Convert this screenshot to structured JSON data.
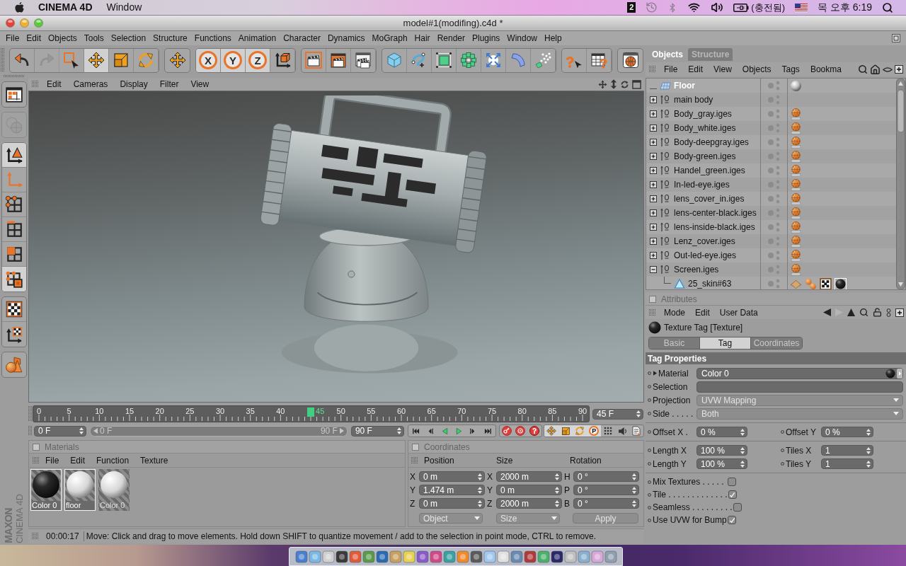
{
  "menubar": {
    "app": "CINEMA 4D",
    "menus": [
      "Window"
    ],
    "spaces": "2",
    "battery": "(충전됨)",
    "clock": "목 오후 6:19"
  },
  "window": {
    "title": "model#1(modifing).c4d *"
  },
  "menu": [
    "File",
    "Edit",
    "Objects",
    "Tools",
    "Selection",
    "Structure",
    "Functions",
    "Animation",
    "Character",
    "Dynamics",
    "MoGraph",
    "Hair",
    "Render",
    "Plugins",
    "Window",
    "Help"
  ],
  "toolbar": [
    {
      "items": [
        {
          "kind": "undo",
          "selected": false,
          "disabled": false
        },
        {
          "kind": "redo",
          "selected": false,
          "disabled": true
        },
        {
          "kind": "select",
          "selected": false,
          "disabled": false
        },
        {
          "kind": "move",
          "selected": true,
          "disabled": false
        },
        {
          "kind": "scale",
          "selected": false,
          "disabled": false
        },
        {
          "kind": "rotate",
          "selected": false,
          "disabled": false
        }
      ]
    },
    {
      "items": [
        {
          "kind": "world"
        }
      ]
    },
    {
      "items": [
        {
          "kind": "lock",
          "label": "X",
          "selected": true
        },
        {
          "kind": "lock",
          "label": "Y",
          "selected": true
        },
        {
          "kind": "lock",
          "label": "Z",
          "selected": true
        },
        {
          "kind": "coords",
          "selected": false
        }
      ]
    },
    {
      "items": [
        {
          "kind": "render_view"
        },
        {
          "kind": "render_viewer"
        },
        {
          "kind": "render_settings"
        }
      ]
    },
    {
      "items": [
        {
          "kind": "cube"
        },
        {
          "kind": "spline"
        },
        {
          "kind": "nurbs"
        },
        {
          "kind": "array"
        },
        {
          "kind": "deformer"
        },
        {
          "kind": "environment"
        },
        {
          "kind": "particles"
        }
      ]
    },
    {
      "items": [
        {
          "kind": "help"
        },
        {
          "kind": "help_table"
        }
      ]
    },
    {
      "items": [
        {
          "kind": "web"
        }
      ]
    }
  ],
  "left_toolbar": [
    {
      "items": [
        {
          "kind": "model",
          "selected": false,
          "disabled": false
        }
      ]
    },
    {
      "items": [
        {
          "kind": "texture",
          "selected": false,
          "disabled": true
        }
      ]
    },
    {
      "items": [
        {
          "kind": "object_axis",
          "selected": true,
          "disabled": false
        },
        {
          "kind": "axis",
          "selected": false,
          "disabled": false
        },
        {
          "kind": "points",
          "selected": false,
          "disabled": false
        },
        {
          "kind": "edges",
          "selected": false,
          "disabled": false
        },
        {
          "kind": "polygons",
          "selected": false,
          "disabled": false
        },
        {
          "kind": "live",
          "selected": true,
          "disabled": false
        }
      ]
    },
    {
      "items": [
        {
          "kind": "texture_mode",
          "selected": false,
          "disabled": false
        },
        {
          "kind": "workplane",
          "selected": false,
          "disabled": false
        }
      ]
    },
    {
      "items": [
        {
          "kind": "primitives",
          "selected": false,
          "disabled": false
        }
      ]
    }
  ],
  "logo": {
    "brand": "MAXON",
    "product": "CINEMA 4D"
  },
  "viewport": {
    "menu": [
      "Edit",
      "Cameras",
      "Display",
      "Filter",
      "View"
    ]
  },
  "timeline": {
    "ticks": [
      {
        "label": "0",
        "selected": false
      },
      {
        "label": "5",
        "selected": false
      },
      {
        "label": "10",
        "selected": false
      },
      {
        "label": "15",
        "selected": false
      },
      {
        "label": "20",
        "selected": false
      },
      {
        "label": "25",
        "selected": false
      },
      {
        "label": "30",
        "selected": false
      },
      {
        "label": "35",
        "selected": false
      },
      {
        "label": "40",
        "selected": false
      },
      {
        "label": "45",
        "selected": true
      },
      {
        "label": "50",
        "selected": false
      },
      {
        "label": "55",
        "selected": false
      },
      {
        "label": "60",
        "selected": false
      },
      {
        "label": "65",
        "selected": false
      },
      {
        "label": "70",
        "selected": false
      },
      {
        "label": "75",
        "selected": false
      },
      {
        "label": "80",
        "selected": false
      },
      {
        "label": "85",
        "selected": false
      },
      {
        "label": "90",
        "selected": false
      }
    ],
    "frame": "45 F",
    "start": "0 F",
    "range": {
      "start": "0 F",
      "end": "90 F",
      "level": 1
    },
    "end": "90 F",
    "keys": [
      {
        "kind": "move",
        "selected": true
      },
      {
        "kind": "scale",
        "selected": true
      },
      {
        "kind": "rotate",
        "selected": true
      },
      {
        "kind": "param",
        "label": "P",
        "selected": true
      },
      {
        "kind": "points",
        "selected": false
      },
      {
        "kind": "sound",
        "selected": false
      },
      {
        "kind": "doc",
        "selected": false
      }
    ]
  },
  "materials": {
    "title": "Materials",
    "menu": [
      "File",
      "Edit",
      "Function",
      "Texture"
    ],
    "items": [
      {
        "name": "Color 0",
        "kind": "dark",
        "selected": true
      },
      {
        "name": "floor",
        "kind": "light",
        "selected": true
      },
      {
        "name": "Color 0",
        "kind": "light",
        "selected": false
      }
    ]
  },
  "coordinates": {
    "title": "Coordinates",
    "headers": [
      "Position",
      "Size",
      "Rotation"
    ],
    "rows": [
      [
        {
          "axis": "X",
          "value": "0 m"
        },
        {
          "axis": "X",
          "value": "2000 m"
        },
        {
          "axis": "H",
          "value": "0 °"
        }
      ],
      [
        {
          "axis": "Y",
          "value": "1.474 m"
        },
        {
          "axis": "Y",
          "value": "0 m"
        },
        {
          "axis": "P",
          "value": "0 °"
        }
      ],
      [
        {
          "axis": "Z",
          "value": "0 m"
        },
        {
          "axis": "Z",
          "value": "2000 m"
        },
        {
          "axis": "B",
          "value": "0 °"
        }
      ]
    ],
    "modes": [
      "Object",
      "Size"
    ],
    "apply": "Apply"
  },
  "status_bar": {
    "time": "00:00:17",
    "message": "Move: Click and drag to move elements. Hold down SHIFT to quantize movement / add to the selection in point mode, CTRL to remove."
  },
  "objects": {
    "tabs": [
      {
        "label": "Objects",
        "selected": true
      },
      {
        "label": "Structure",
        "selected": false
      }
    ],
    "menu": [
      "File",
      "Edit",
      "View",
      "Objects",
      "Tags",
      "Bookma"
    ],
    "tree": [
      {
        "name": "Floor",
        "kind": "floor",
        "selected": true,
        "tags": [
          {
            "kind": "sphere",
            "selected": false
          }
        ]
      },
      {
        "name": "main body",
        "kind": "null",
        "selected": false,
        "expanded": false
      },
      {
        "name": "Body_gray.iges",
        "kind": "null",
        "selected": false,
        "expanded": false,
        "tags": [
          {
            "kind": "iges",
            "selected": false
          }
        ]
      },
      {
        "name": "Body_white.iges",
        "kind": "null",
        "selected": false,
        "expanded": false,
        "tags": [
          {
            "kind": "iges",
            "selected": false
          }
        ]
      },
      {
        "name": "Body-deepgray.iges",
        "kind": "null",
        "selected": false,
        "expanded": false,
        "tags": [
          {
            "kind": "iges",
            "selected": false
          }
        ]
      },
      {
        "name": "Body-green.iges",
        "kind": "null",
        "selected": false,
        "expanded": false,
        "tags": [
          {
            "kind": "iges",
            "selected": false
          }
        ]
      },
      {
        "name": "Handel_green.iges",
        "kind": "null",
        "selected": false,
        "expanded": false,
        "tags": [
          {
            "kind": "iges",
            "selected": false
          }
        ]
      },
      {
        "name": "In-led-eye.iges",
        "kind": "null",
        "selected": false,
        "expanded": false,
        "tags": [
          {
            "kind": "iges",
            "selected": false
          }
        ]
      },
      {
        "name": "lens_cover_in.iges",
        "kind": "null",
        "selected": false,
        "expanded": false,
        "tags": [
          {
            "kind": "iges",
            "selected": false
          }
        ]
      },
      {
        "name": "lens-center-black.iges",
        "kind": "null",
        "selected": false,
        "expanded": false,
        "tags": [
          {
            "kind": "iges",
            "selected": false
          }
        ]
      },
      {
        "name": "lens-inside-black.iges",
        "kind": "null",
        "selected": false,
        "expanded": false,
        "tags": [
          {
            "kind": "iges",
            "selected": false
          }
        ]
      },
      {
        "name": "Lenz_cover.iges",
        "kind": "null",
        "selected": false,
        "expanded": false,
        "tags": [
          {
            "kind": "iges",
            "selected": false
          }
        ]
      },
      {
        "name": "Out-led-eye.iges",
        "kind": "null",
        "selected": false,
        "expanded": false,
        "tags": [
          {
            "kind": "iges",
            "selected": false
          }
        ]
      },
      {
        "name": "Screen.iges",
        "kind": "null",
        "selected": false,
        "expanded": true,
        "tags": [
          {
            "kind": "iges",
            "selected": false
          }
        ],
        "children": [
          {
            "name": "25_skin#63",
            "kind": "polygon",
            "selected": false,
            "tags": [
              {
                "kind": "phong",
                "selected": false
              },
              {
                "kind": "spheres",
                "selected": false
              },
              {
                "kind": "checker",
                "selected": false
              },
              {
                "kind": "ball",
                "selected": true
              }
            ]
          }
        ]
      }
    ]
  },
  "attributes": {
    "title": "Attributes",
    "menu": [
      "Mode",
      "Edit",
      "User Data"
    ],
    "object": "Texture Tag [Texture]",
    "tabs": [
      {
        "label": "Basic",
        "selected": false
      },
      {
        "label": "Tag",
        "selected": true
      },
      {
        "label": "Coordinates",
        "selected": false
      }
    ],
    "section": "Tag Properties",
    "fields": [
      {
        "kind": "link",
        "label": "Material",
        "value": "Color 0"
      },
      {
        "kind": "text",
        "label": "Selection"
      },
      {
        "kind": "dropdown",
        "label": "Projection",
        "value": "UVW Mapping"
      },
      {
        "kind": "dropdown",
        "label": "Side . . . . .",
        "value": "Both"
      }
    ],
    "groups": [
      [
        [
          {
            "label": "Offset X .",
            "value": "0 %"
          },
          {
            "label": "Offset Y",
            "value": "0 %"
          }
        ]
      ],
      [
        [
          {
            "label": "Length X",
            "value": "100 %"
          },
          {
            "label": "Tiles X",
            "value": "1"
          }
        ],
        [
          {
            "label": "Length Y",
            "value": "100 %"
          },
          {
            "label": "Tiles Y",
            "value": "1"
          }
        ]
      ]
    ],
    "checks": [
      {
        "label": "Mix Textures . . . . .",
        "checked": false
      },
      {
        "label": "Tile . . . . . . . . . . . . .",
        "checked": true
      },
      {
        "label": "Seamless . . . . . . . . .",
        "checked": false
      },
      {
        "label": "Use UVW for Bump",
        "checked": true
      }
    ]
  }
}
